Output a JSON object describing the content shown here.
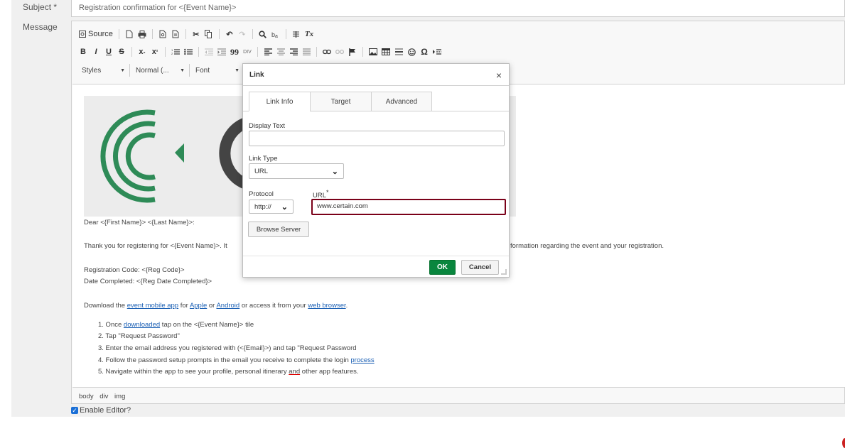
{
  "form": {
    "subject_label": "Subject",
    "required_mark": "*",
    "subject_value": "Registration confirmation for <{Event Name}>",
    "message_label": "Message",
    "enable_editor_label": "Enable Editor?"
  },
  "toolbar": {
    "source_label": "Source",
    "styles_label": "Styles",
    "format_label": "Normal (...",
    "font_label": "Font",
    "bold": "B",
    "italic": "I",
    "underline": "U",
    "strike": "S",
    "quote": "99",
    "omega": "Ω"
  },
  "content": {
    "greeting": "Dear <{First Name}> <{Last Name}>:",
    "thanks_part1": "Thank you for registering for <{Event Name}>. It",
    "thanks_part2": "formation regarding the event and your registration.",
    "reg_code": "Registration Code: <{Reg Code}>",
    "date_completed": "Date Completed: <{Reg Date Completed}>",
    "download_pre": "Download the ",
    "download_link_app": "event mobile app",
    "download_for": " for ",
    "download_link_apple": "Apple",
    "download_or": " or ",
    "download_link_android": "Android",
    "download_access": " or access it from your ",
    "download_link_browser": "web browser",
    "download_end": ".",
    "step1_pre": "1. Once ",
    "step1_link": "downloaded",
    "step1_post": " tap on the <{Event Name}> tile",
    "step2": "2. Tap \"Request Password\"",
    "step3": "3. Enter the email address you registered with (<{Email}>) and tap \"Request Password",
    "step4_pre": "4. Follow the password setup prompts in the email you receive to complete the login ",
    "step4_link": "process",
    "step5_pre": "5. Navigate within the app to see your profile, personal itinerary ",
    "step5_and": "and",
    "step5_post": " other app features."
  },
  "path_bar": [
    "body",
    "div",
    "img"
  ],
  "dialog": {
    "title": "Link",
    "close": "×",
    "tabs": [
      {
        "label": "Link Info",
        "active": true
      },
      {
        "label": "Target",
        "active": false
      },
      {
        "label": "Advanced",
        "active": false
      }
    ],
    "display_text_label": "Display Text",
    "display_text_value": "",
    "link_type_label": "Link Type",
    "link_type_value": "URL",
    "protocol_label": "Protocol",
    "protocol_value": "http://",
    "url_label": "URL",
    "url_required": "*",
    "url_value": "www.certain.com",
    "browse_server_label": "Browse Server",
    "ok_label": "OK",
    "cancel_label": "Cancel"
  },
  "colors": {
    "ok_button": "#09863e",
    "url_focus_border": "#7a0019",
    "link_text": "#1a5fb4",
    "logo_green": "#2e8b57"
  }
}
